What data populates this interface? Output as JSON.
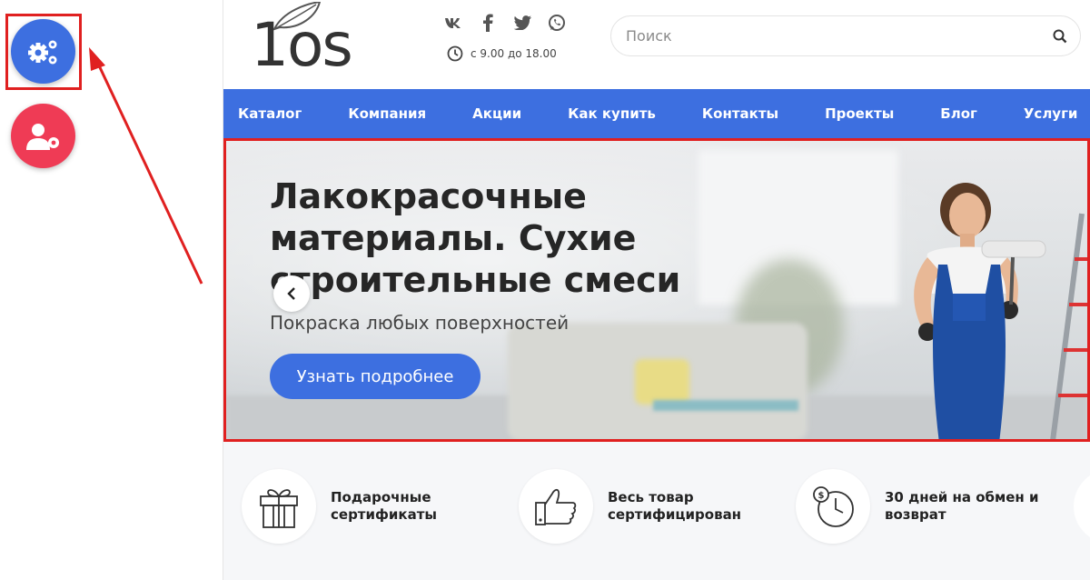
{
  "header": {
    "logo_text": "1os",
    "hours": "с 9.00 до 18.00",
    "search_placeholder": "Поиск",
    "social": [
      {
        "icon": "vk-icon",
        "glyph": "vk"
      },
      {
        "icon": "facebook-icon",
        "glyph": "f"
      },
      {
        "icon": "twitter-icon",
        "glyph": "t"
      },
      {
        "icon": "whatsapp-icon",
        "glyph": "w"
      }
    ]
  },
  "nav": {
    "items": [
      "Каталог",
      "Компания",
      "Акции",
      "Как купить",
      "Контакты",
      "Проекты",
      "Блог",
      "Услуги"
    ]
  },
  "hero": {
    "title": "Лакокрасочные материалы. Сухие строительные смеси",
    "subtitle": "Покраска любых поверхностей",
    "button_label": "Узнать подробнее"
  },
  "features": [
    {
      "label": "Подарочные сертификаты",
      "icon": "gift-icon"
    },
    {
      "label": "Весь товар сертифицирован",
      "icon": "thumbs-up-icon"
    },
    {
      "label": "30 дней на обмен и возврат",
      "icon": "clock-money-icon"
    }
  ],
  "colors": {
    "accent": "#3d6fe0",
    "user_button": "#ef3b55",
    "highlight": "#e02020"
  }
}
